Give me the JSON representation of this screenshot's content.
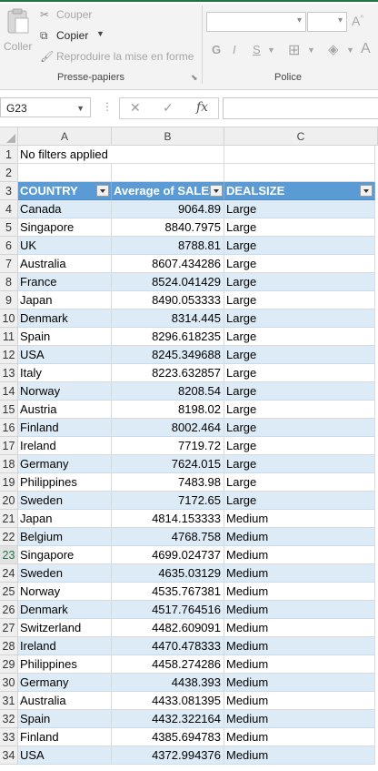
{
  "ribbon": {
    "clipboard": {
      "paste_label": "Coller",
      "cut_label": "Couper",
      "copy_label": "Copier",
      "format_painter_label": "Reproduire la mise en forme",
      "group_label": "Presse-papiers"
    },
    "font": {
      "bold": "G",
      "italic": "I",
      "underline": "S",
      "group_label": "Police"
    }
  },
  "formula_bar": {
    "name_box": "G23",
    "fx_label": "fx",
    "cancel_glyph": "✕",
    "enter_glyph": "✓",
    "formula_value": ""
  },
  "columns": [
    "A",
    "B",
    "C"
  ],
  "row_numbers": [
    "1",
    "2",
    "3",
    "4",
    "5",
    "6",
    "7",
    "8",
    "9",
    "10",
    "11",
    "12",
    "13",
    "14",
    "15",
    "16",
    "17",
    "18",
    "19",
    "20",
    "21",
    "22",
    "23",
    "24",
    "25",
    "26",
    "27",
    "28",
    "29",
    "30",
    "31",
    "32",
    "33",
    "34"
  ],
  "sheet": {
    "filter_note": "No filters applied",
    "headers": [
      "COUNTRY",
      "Average of SALES",
      "DEALSIZE"
    ],
    "rows": [
      {
        "country": "Canada",
        "avg_sales": "9064.89",
        "dealsize": "Large"
      },
      {
        "country": "Singapore",
        "avg_sales": "8840.7975",
        "dealsize": "Large"
      },
      {
        "country": "UK",
        "avg_sales": "8788.81",
        "dealsize": "Large"
      },
      {
        "country": "Australia",
        "avg_sales": "8607.434286",
        "dealsize": "Large"
      },
      {
        "country": "France",
        "avg_sales": "8524.041429",
        "dealsize": "Large"
      },
      {
        "country": "Japan",
        "avg_sales": "8490.053333",
        "dealsize": "Large"
      },
      {
        "country": "Denmark",
        "avg_sales": "8314.445",
        "dealsize": "Large"
      },
      {
        "country": "Spain",
        "avg_sales": "8296.618235",
        "dealsize": "Large"
      },
      {
        "country": "USA",
        "avg_sales": "8245.349688",
        "dealsize": "Large"
      },
      {
        "country": "Italy",
        "avg_sales": "8223.632857",
        "dealsize": "Large"
      },
      {
        "country": "Norway",
        "avg_sales": "8208.54",
        "dealsize": "Large"
      },
      {
        "country": "Austria",
        "avg_sales": "8198.02",
        "dealsize": "Large"
      },
      {
        "country": "Finland",
        "avg_sales": "8002.464",
        "dealsize": "Large"
      },
      {
        "country": "Ireland",
        "avg_sales": "7719.72",
        "dealsize": "Large"
      },
      {
        "country": "Germany",
        "avg_sales": "7624.015",
        "dealsize": "Large"
      },
      {
        "country": "Philippines",
        "avg_sales": "7483.98",
        "dealsize": "Large"
      },
      {
        "country": "Sweden",
        "avg_sales": "7172.65",
        "dealsize": "Large"
      },
      {
        "country": "Japan",
        "avg_sales": "4814.153333",
        "dealsize": "Medium"
      },
      {
        "country": "Belgium",
        "avg_sales": "4768.758",
        "dealsize": "Medium"
      },
      {
        "country": "Singapore",
        "avg_sales": "4699.024737",
        "dealsize": "Medium"
      },
      {
        "country": "Sweden",
        "avg_sales": "4635.03129",
        "dealsize": "Medium"
      },
      {
        "country": "Norway",
        "avg_sales": "4535.767381",
        "dealsize": "Medium"
      },
      {
        "country": "Denmark",
        "avg_sales": "4517.764516",
        "dealsize": "Medium"
      },
      {
        "country": "Switzerland",
        "avg_sales": "4482.609091",
        "dealsize": "Medium"
      },
      {
        "country": "Ireland",
        "avg_sales": "4470.478333",
        "dealsize": "Medium"
      },
      {
        "country": "Philippines",
        "avg_sales": "4458.274286",
        "dealsize": "Medium"
      },
      {
        "country": "Germany",
        "avg_sales": "4438.393",
        "dealsize": "Medium"
      },
      {
        "country": "Australia",
        "avg_sales": "4433.081395",
        "dealsize": "Medium"
      },
      {
        "country": "Spain",
        "avg_sales": "4432.322164",
        "dealsize": "Medium"
      },
      {
        "country": "Finland",
        "avg_sales": "4385.694783",
        "dealsize": "Medium"
      },
      {
        "country": "USA",
        "avg_sales": "4372.994376",
        "dealsize": "Medium"
      }
    ]
  },
  "colors": {
    "header_fill": "#5b9bd5",
    "band_fill": "#ddebf7",
    "excel_green": "#217346"
  }
}
